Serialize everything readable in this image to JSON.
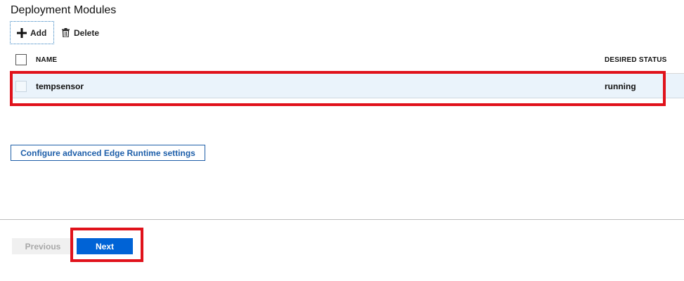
{
  "page": {
    "title": "Deployment Modules"
  },
  "toolbar": {
    "add": {
      "label": "Add",
      "icon": "plus-icon"
    },
    "delete": {
      "label": "Delete",
      "icon": "trash-icon"
    }
  },
  "table": {
    "columns": [
      "NAME",
      "DESIRED STATUS"
    ],
    "rows": [
      {
        "name": "tempsensor",
        "desired_status": "running",
        "selected": false
      }
    ]
  },
  "actions": {
    "configure_label": "Configure advanced Edge Runtime settings"
  },
  "footer": {
    "previous_label": "Previous",
    "previous_enabled": false,
    "next_label": "Next"
  },
  "colors": {
    "accent": "#0063d6",
    "row_highlight": "#eaf3fb",
    "annotation_red": "#e0121b",
    "link_blue": "#1d5ea9"
  }
}
